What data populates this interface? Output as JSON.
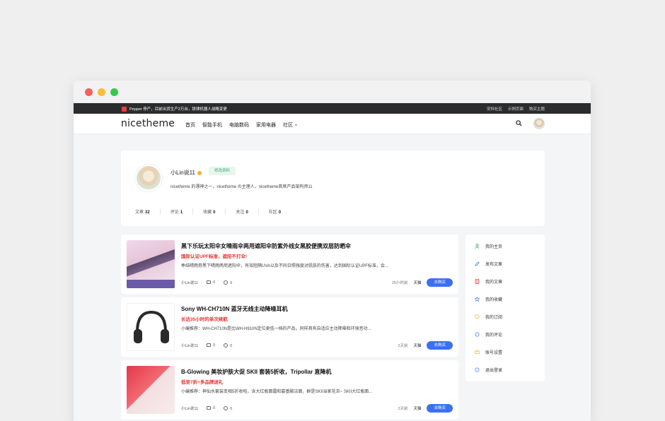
{
  "topbar": {
    "notice": "Pepper 停产，目前出货生产2万台，铁律机器人战略变更",
    "links": [
      "安科社区",
      "示例页面",
      "购买主题"
    ]
  },
  "navbar": {
    "logo": "nicetheme",
    "items": [
      "首页",
      "智能手机",
      "电脑数码",
      "家用电器",
      "社区"
    ]
  },
  "profile": {
    "name": "小Lin说11",
    "edit_label": "修改资料",
    "bio": "nicetheme 的漂神之一，nicetheme の主理人，nicetheme首席产品架构师11",
    "stats": [
      {
        "label": "文章",
        "value": "32"
      },
      {
        "label": "评论",
        "value": "1"
      },
      {
        "label": "收藏",
        "value": "0"
      },
      {
        "label": "关注",
        "value": "0"
      },
      {
        "label": "社区",
        "value": "0"
      }
    ]
  },
  "feed": [
    {
      "title": "黑下乐玩太阳伞女晴雨伞两用遮阳伞防紫外线女黑胶便携双层防晒伞",
      "subtitle": "国际认证UPF标准，遮阳不打伞!",
      "desc": "季结晴雨券黑下晴雨两用遮阳伞，有效阻隔UVA以及不同日照强度对肌肤的伤害，达到国际认证UPF标准，会...",
      "author": "小Lin说11",
      "comments": "0",
      "likes": "0",
      "time": "25小时前",
      "store": "天猫",
      "buy_label": "去购买"
    },
    {
      "title": "Sony WH-CH710N 蓝牙无线主动降噪耳机",
      "subtitle": "长达35小时的单次续航",
      "desc": "小编推荐：WH-CH710N是比WH-H910N定位更低一档的产品，同样具有自适应主动降噪和环境音功...",
      "author": "小Lin说11",
      "comments": "0",
      "likes": "0",
      "time": "2天前",
      "store": "天猫",
      "buy_label": "去购买"
    },
    {
      "title": "B-Glowing 美妆护肤大促 SKII 套装5折收，Tripollar 直降机",
      "subtitle": "低至7折+多品牌送礼",
      "desc": "小编推荐：神仙水套装变相5折收啦，含大红瓶面霜和募基酸洁面，群是SKII当家花旦~ SKII大红瓶面...",
      "author": "小Lin说11",
      "comments": "0",
      "likes": "0",
      "time": "2天前",
      "store": "天猫",
      "buy_label": "去购买"
    }
  ],
  "sidebar": {
    "items": [
      {
        "label": "我的主页",
        "icon": "user-icon",
        "color": "#3cab6e"
      },
      {
        "label": "发布文章",
        "icon": "pencil-icon",
        "color": "#3b6ff5"
      },
      {
        "label": "我的文章",
        "icon": "document-icon",
        "color": "#e5322d"
      },
      {
        "label": "我的收藏",
        "icon": "star-icon",
        "color": "#3b6ff5"
      },
      {
        "label": "我的订阅",
        "icon": "tag-icon",
        "color": "#f3b52a"
      },
      {
        "label": "我的评论",
        "icon": "comment-icon",
        "color": "#3b6ff5"
      },
      {
        "label": "账号设置",
        "icon": "card-icon",
        "color": "#f3b52a"
      },
      {
        "label": "退出登录",
        "icon": "logout-icon",
        "color": "#3b6ff5"
      }
    ]
  }
}
